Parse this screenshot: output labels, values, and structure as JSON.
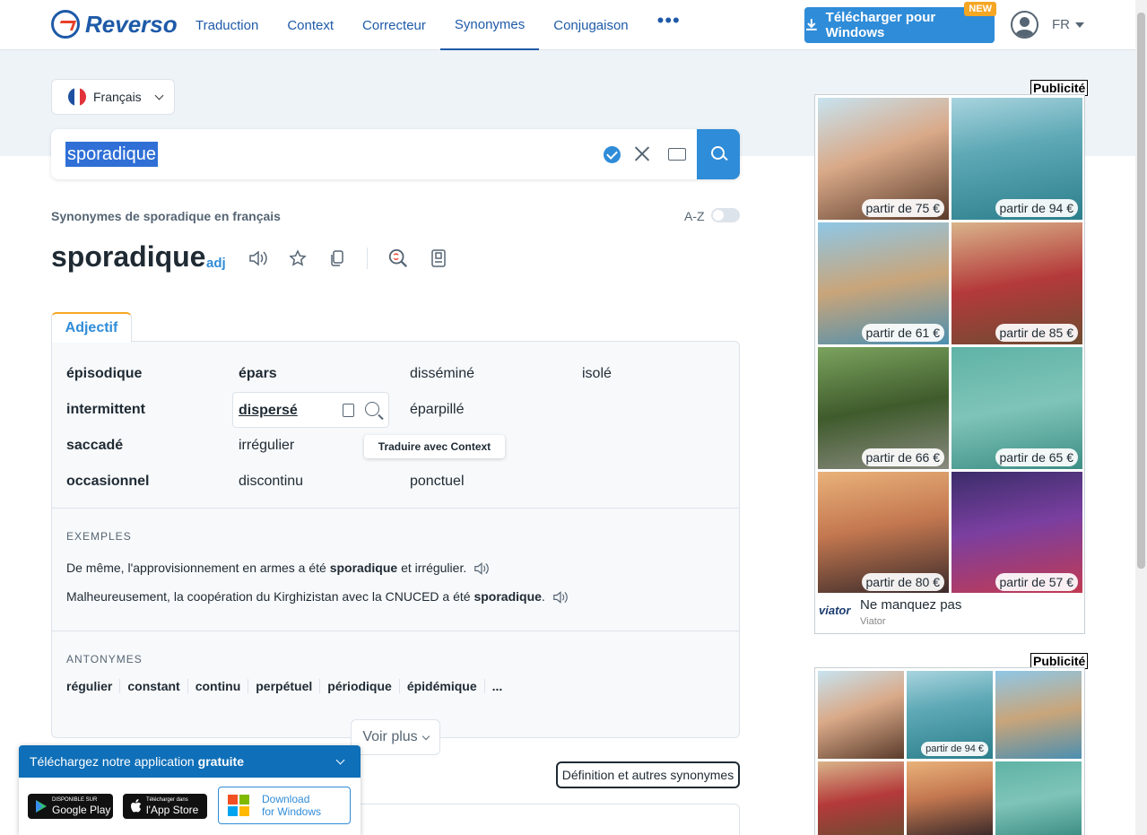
{
  "header": {
    "logo": "Reverso",
    "nav": [
      "Traduction",
      "Context",
      "Correcteur",
      "Synonymes",
      "Conjugaison",
      "•••"
    ],
    "download_label": "Télécharger pour Windows",
    "new_badge": "NEW",
    "language": "FR"
  },
  "source_language": "Français",
  "search": {
    "value": "sporadique"
  },
  "subtitle": "Synonymes de sporadique en français",
  "az_label": "A-Z",
  "headword": "sporadique",
  "pos": "adj",
  "tab_label": "Adjectif",
  "synonyms": {
    "col1": [
      "épisodique",
      "intermittent",
      "saccadé",
      "occasionnel"
    ],
    "col2": [
      "épars",
      "dispersé",
      "irrégulier",
      "discontinu"
    ],
    "col3": [
      "disséminé",
      "éparpillé",
      "ponctuel"
    ],
    "col4": [
      "isolé"
    ]
  },
  "tooltip": "Traduire avec Context",
  "examples_label": "EXEMPLES",
  "examples": [
    {
      "before": "De même, l'approvisionnement en armes a été ",
      "bold": "sporadique",
      "after": " et irrégulier."
    },
    {
      "before": "Malheureusement, la coopération du Kirghizistan avec la CNUCED a été ",
      "bold": "sporadique",
      "after": "."
    }
  ],
  "antonyms_label": "ANTONYMES",
  "antonyms": [
    "régulier",
    "constant",
    "continu",
    "perpétuel",
    "périodique",
    "épidémique",
    "..."
  ],
  "voir_plus": "Voir plus",
  "definition_button": "Définition et autres synonymes",
  "app_banner": {
    "title": "Téléchargez notre application",
    "title_bold": "gratuite",
    "google_small": "DISPONIBLE SUR",
    "google_big": "Google Play",
    "apple_small": "Télécharger dans",
    "apple_big": "l'App Store",
    "windows_line1": "Download",
    "windows_line2": "for Windows"
  },
  "ads": {
    "label": "Publicité",
    "prices": [
      "partir de 75 €",
      "partir de 94 €",
      "partir de 61 €",
      "partir de 85 €",
      "partir de 66 €",
      "partir de 65 €",
      "partir de 80 €",
      "partir de 57 €"
    ],
    "cta": "Ne manquez pas",
    "brand": "Viator",
    "brand_logo": "viator",
    "second_price": "partir de 94 €"
  },
  "colors": {
    "brand": "#1e5aa8",
    "accent": "#2f8cd8",
    "highlight": "#2f6fd6",
    "tab_accent": "#f5a623"
  }
}
